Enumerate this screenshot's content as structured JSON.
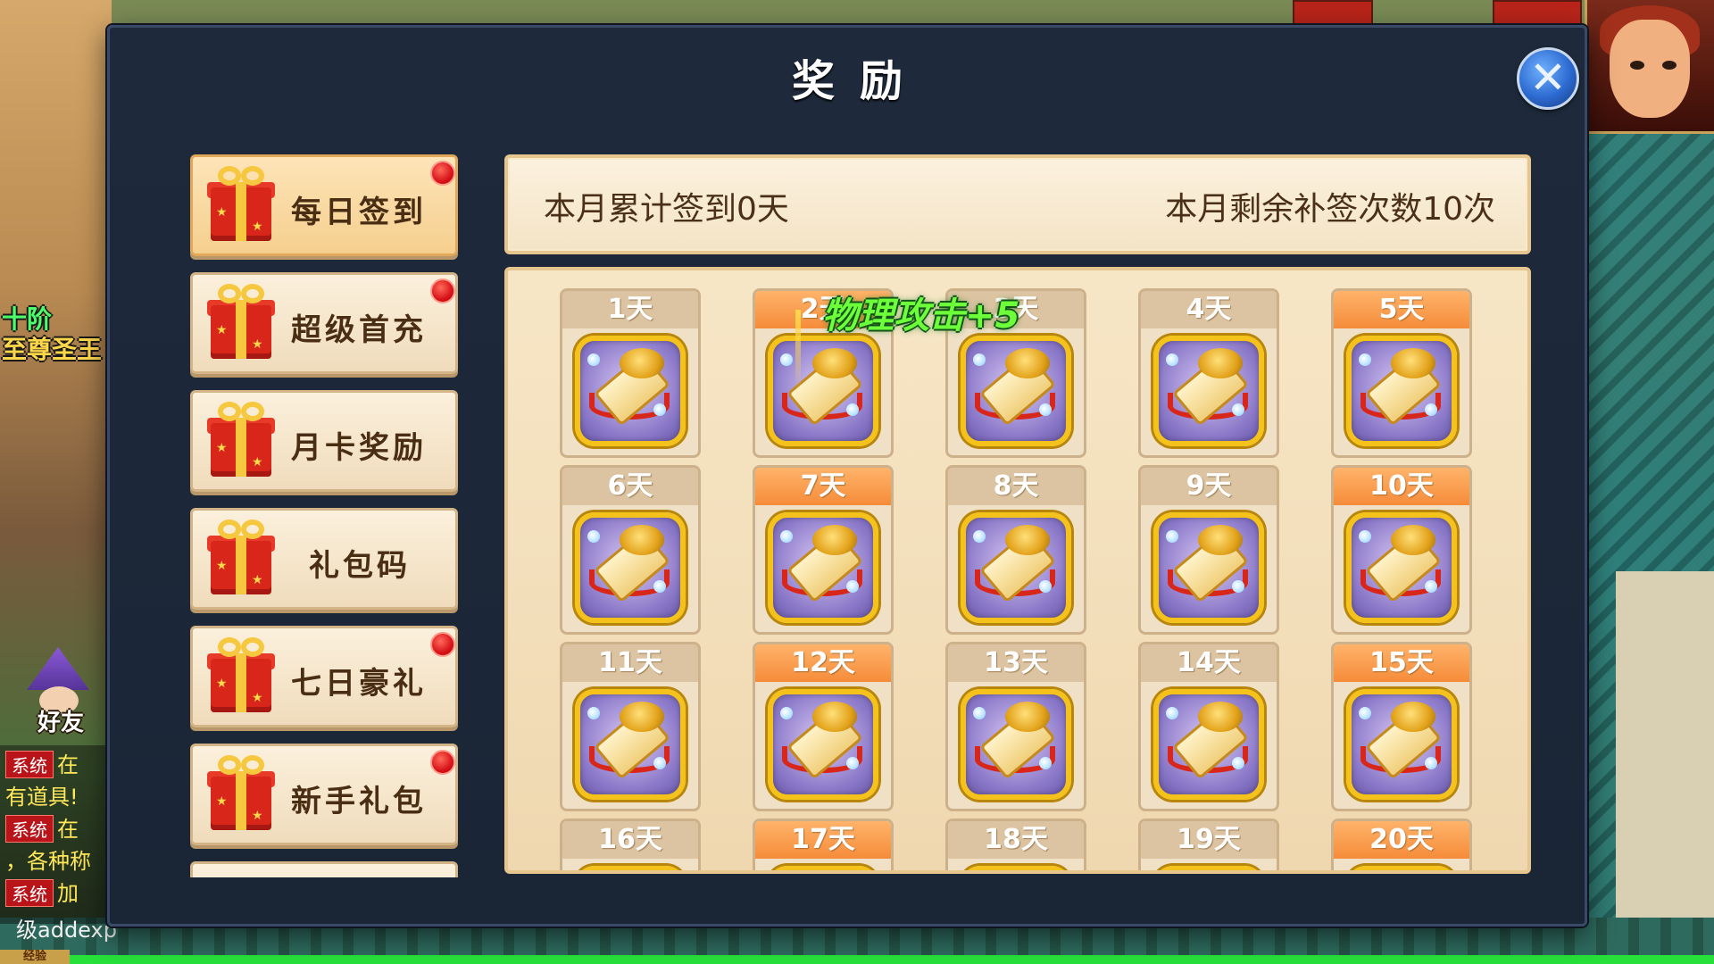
{
  "modal": {
    "title": "奖励",
    "close_icon": "close-icon",
    "close_glyph": "✕"
  },
  "menu": {
    "items": [
      {
        "label": "每日签到",
        "badge": true,
        "active": true
      },
      {
        "label": "超级首充",
        "badge": true,
        "active": false
      },
      {
        "label": "月卡奖励",
        "badge": false,
        "active": false
      },
      {
        "label": "礼包码",
        "badge": false,
        "active": false
      },
      {
        "label": "七日豪礼",
        "badge": true,
        "active": false
      },
      {
        "label": "新手礼包",
        "badge": true,
        "active": false
      }
    ]
  },
  "signin": {
    "accumulated_text": "本月累计签到0天",
    "makeup_remaining_text": "本月剩余补签次数10次",
    "floating_bonus": "物理攻击+5",
    "days": [
      {
        "label": "1天",
        "vip": false
      },
      {
        "label": "2天",
        "vip": true
      },
      {
        "label": "3天",
        "vip": false
      },
      {
        "label": "4天",
        "vip": false
      },
      {
        "label": "5天",
        "vip": true
      },
      {
        "label": "6天",
        "vip": false
      },
      {
        "label": "7天",
        "vip": true
      },
      {
        "label": "8天",
        "vip": false
      },
      {
        "label": "9天",
        "vip": false
      },
      {
        "label": "10天",
        "vip": true
      },
      {
        "label": "11天",
        "vip": false
      },
      {
        "label": "12天",
        "vip": true
      },
      {
        "label": "13天",
        "vip": false
      },
      {
        "label": "14天",
        "vip": false
      },
      {
        "label": "15天",
        "vip": true
      },
      {
        "label": "16天",
        "vip": false
      },
      {
        "label": "17天",
        "vip": true
      },
      {
        "label": "18天",
        "vip": false
      },
      {
        "label": "19天",
        "vip": false
      },
      {
        "label": "20天",
        "vip": true
      }
    ],
    "reward_icon": "scroll-icon"
  },
  "background": {
    "player_level": "十阶",
    "player_title": "至尊圣王",
    "friend_label": "好友",
    "chat": [
      {
        "tag": "系统",
        "text": "在"
      },
      {
        "tag": "",
        "text": "有道具!"
      },
      {
        "tag": "系统",
        "text": "在"
      },
      {
        "tag": "",
        "text": "，各种称"
      },
      {
        "tag": "系统",
        "text": "加"
      }
    ],
    "chat_command": "级addexp",
    "xp_label": "经验",
    "xp_fraction": 1.0
  }
}
